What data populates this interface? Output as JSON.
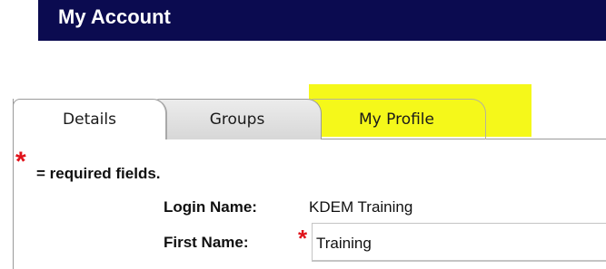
{
  "header": {
    "title": "My Account",
    "background_color": "#0b0b50"
  },
  "tabs": [
    {
      "label": "Details",
      "active": true
    },
    {
      "label": "Groups",
      "active": false
    },
    {
      "label": "My Profile",
      "active": false,
      "highlighted": true
    }
  ],
  "highlight_color": "#f5f81a",
  "required_note": {
    "marker": "*",
    "text": "= required fields."
  },
  "form": {
    "login_name_label": "Login Name:",
    "login_name_value": "KDEM Training",
    "first_name_label": "First Name:",
    "first_name_required_marker": "*",
    "first_name_value": "Training"
  },
  "required_color": "#e0121a"
}
